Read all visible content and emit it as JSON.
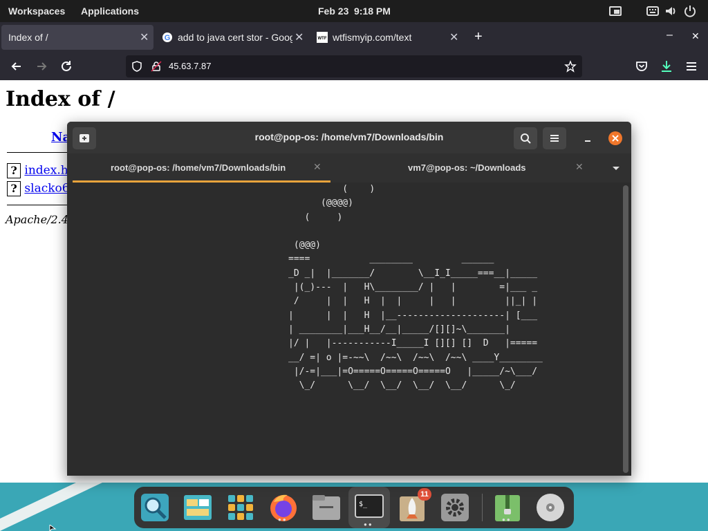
{
  "top_panel": {
    "workspaces": "Workspaces",
    "applications": "Applications",
    "date": "Feb 23",
    "time": "9:18 PM",
    "tray_icons": [
      "screenshot-icon",
      "keyboard-icon",
      "volume-icon",
      "power-icon"
    ]
  },
  "browser": {
    "tabs": [
      {
        "title": "Index of /",
        "active": true
      },
      {
        "title": "add to java cert stor - Goog",
        "active": false,
        "favicon": "G"
      },
      {
        "title": "wtfismyip.com/text",
        "active": false,
        "favicon": "WTF"
      }
    ],
    "new_tab_symbol": "+",
    "url": "45.63.7.87"
  },
  "webpage": {
    "heading": "Index of /",
    "name_header": "Na",
    "files": [
      "index.ht",
      "slacko6"
    ],
    "footer": "Apache/2.4"
  },
  "terminal": {
    "title": "root@pop-os: /home/vm7/Downloads/bin",
    "tabs": [
      {
        "label": "root@pop-os: /home/vm7/Downloads/bin",
        "active": true
      },
      {
        "label": "vm7@pop-os: ~/Downloads",
        "active": false
      }
    ],
    "output": "          (    )\n      (@@@@)\n   (     )\n\n (@@@)\n====           ________         ______\n_D _|  |_______/        \\__I_I_____===__|_____\n |(_)---  |   H\\________/ |   |        =|___ _\n /     |  |   H  |  |     |   |         ||_| |\n|      |  |   H  |__--------------------| [___\n| ________|___H__/__|_____/[][]~\\_______|\n|/ |   |-----------I_____I [][] []  D   |=====\n__/ =| o |=-~~\\  /~~\\  /~~\\  /~~\\ ____Y________\n |/-=|___|=O=====O=====O=====O   |_____/~\\___/\n  \\_/      \\__/  \\__/  \\__/  \\__/      \\_/"
  },
  "dock": {
    "apps": [
      "search-app",
      "files-viewer",
      "app-grid",
      "firefox",
      "file-manager",
      "terminal",
      "launcher",
      "settings",
      "archive-manager",
      "disk-utility"
    ],
    "launcher_badge": "11"
  },
  "colors": {
    "panel": "#1d1d1d",
    "browser_chrome": "#2b2a33",
    "terminal_bg": "#2c2c2c",
    "tab_accent": "#e8a33c",
    "close_button": "#f0772b",
    "wallpaper": "#3aa7b6",
    "link": "#0000ee"
  }
}
